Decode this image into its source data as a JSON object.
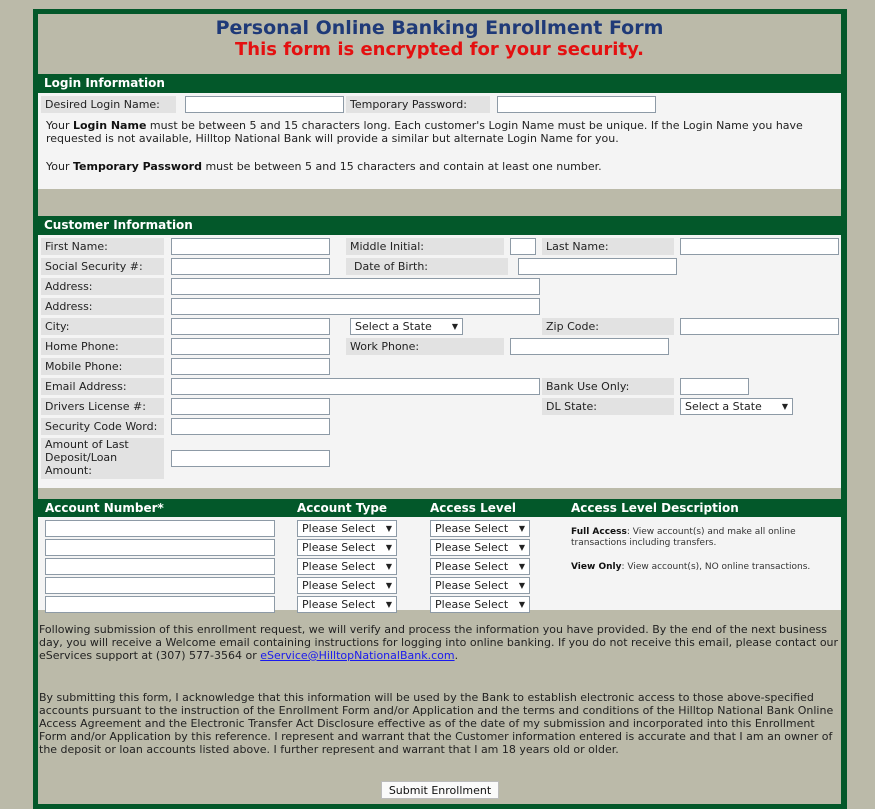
{
  "header": {
    "title": "Personal Online Banking Enrollment Form",
    "subtitle": "This form is encrypted for your security."
  },
  "login": {
    "section_title": "Login Information",
    "login_name_label": "Desired Login Name:",
    "login_name_value": "",
    "temp_password_label": "Temporary Password:",
    "temp_password_value": "",
    "note1_prefix": "Your ",
    "note1_bold": "Login Name",
    "note1_rest": " must be between 5 and 15 characters long. Each customer's Login Name must be unique. If the Login Name you have requested is not available, Hilltop National Bank will provide a similar but alternate Login Name for you.",
    "note2_prefix": "Your ",
    "note2_bold": "Temporary Password",
    "note2_rest": " must be between 5 and 15 characters and contain at least one number."
  },
  "customer": {
    "section_title": "Customer Information",
    "first_name": "First Name:",
    "middle_initial": "Middle Initial:",
    "last_name": "Last Name:",
    "ssn": "Social Security #:",
    "dob": "Date of Birth:",
    "address1": "Address:",
    "address2": "Address:",
    "city": "City:",
    "state_select": "Select a State",
    "zip": "Zip Code:",
    "home_phone": "Home Phone:",
    "work_phone": "Work Phone:",
    "mobile_phone": "Mobile Phone:",
    "email": "Email Address:",
    "bank_use": "Bank Use Only:",
    "drivers_license": "Drivers License #:",
    "dl_state": "DL State:",
    "dl_state_select": "Select a State",
    "security_word": "Security Code Word:",
    "last_deposit": "Amount of Last Deposit/Loan Amount:"
  },
  "accounts": {
    "col_number": "Account Number*",
    "col_type": "Account Type",
    "col_access": "Access Level",
    "col_desc": "Access Level Description",
    "rows": [
      {
        "number": "",
        "type": "Please Select",
        "access": "Please Select"
      },
      {
        "number": "",
        "type": "Please Select",
        "access": "Please Select"
      },
      {
        "number": "",
        "type": "Please Select",
        "access": "Please Select"
      },
      {
        "number": "",
        "type": "Please Select",
        "access": "Please Select"
      },
      {
        "number": "",
        "type": "Please Select",
        "access": "Please Select"
      }
    ],
    "full_access_label": "Full Access",
    "full_access_text": ": View account(s) and make all online transactions including transfers.",
    "view_only_label": "View Only",
    "view_only_text": ": View account(s), NO online transactions."
  },
  "footer": {
    "para1_text": "Following submission of this enrollment request, we will verify and process the information you have provided. By the end of the next business day, you will receive a Welcome email containing instructions for logging into online banking. If you do not receive this email, please contact our eServices support at (307) 577-3564 or ",
    "para1_link": "eService@HilltopNationalBank.com",
    "para1_end": ".",
    "para2": "By submitting this form, I acknowledge that this information will be used by the Bank to establish electronic access to those above-specified accounts pursuant to the instruction of the Enrollment Form and/or Application and the terms and conditions of the Hilltop National Bank Online Access Agreement and the Electronic Transfer Act Disclosure effective as of the date of my submission and incorporated into this Enrollment Form and/or Application by this reference. I represent and warrant that the Customer information entered is accurate and that I am an owner of the deposit or loan accounts listed above. I further represent and warrant that I am 18 years old or older.",
    "submit_label": "Submit Enrollment"
  },
  "colors": {
    "brand_green": "#03582a",
    "background": "#bbbaa9",
    "title_blue": "#1f3a78",
    "alert_red": "#e41010"
  }
}
